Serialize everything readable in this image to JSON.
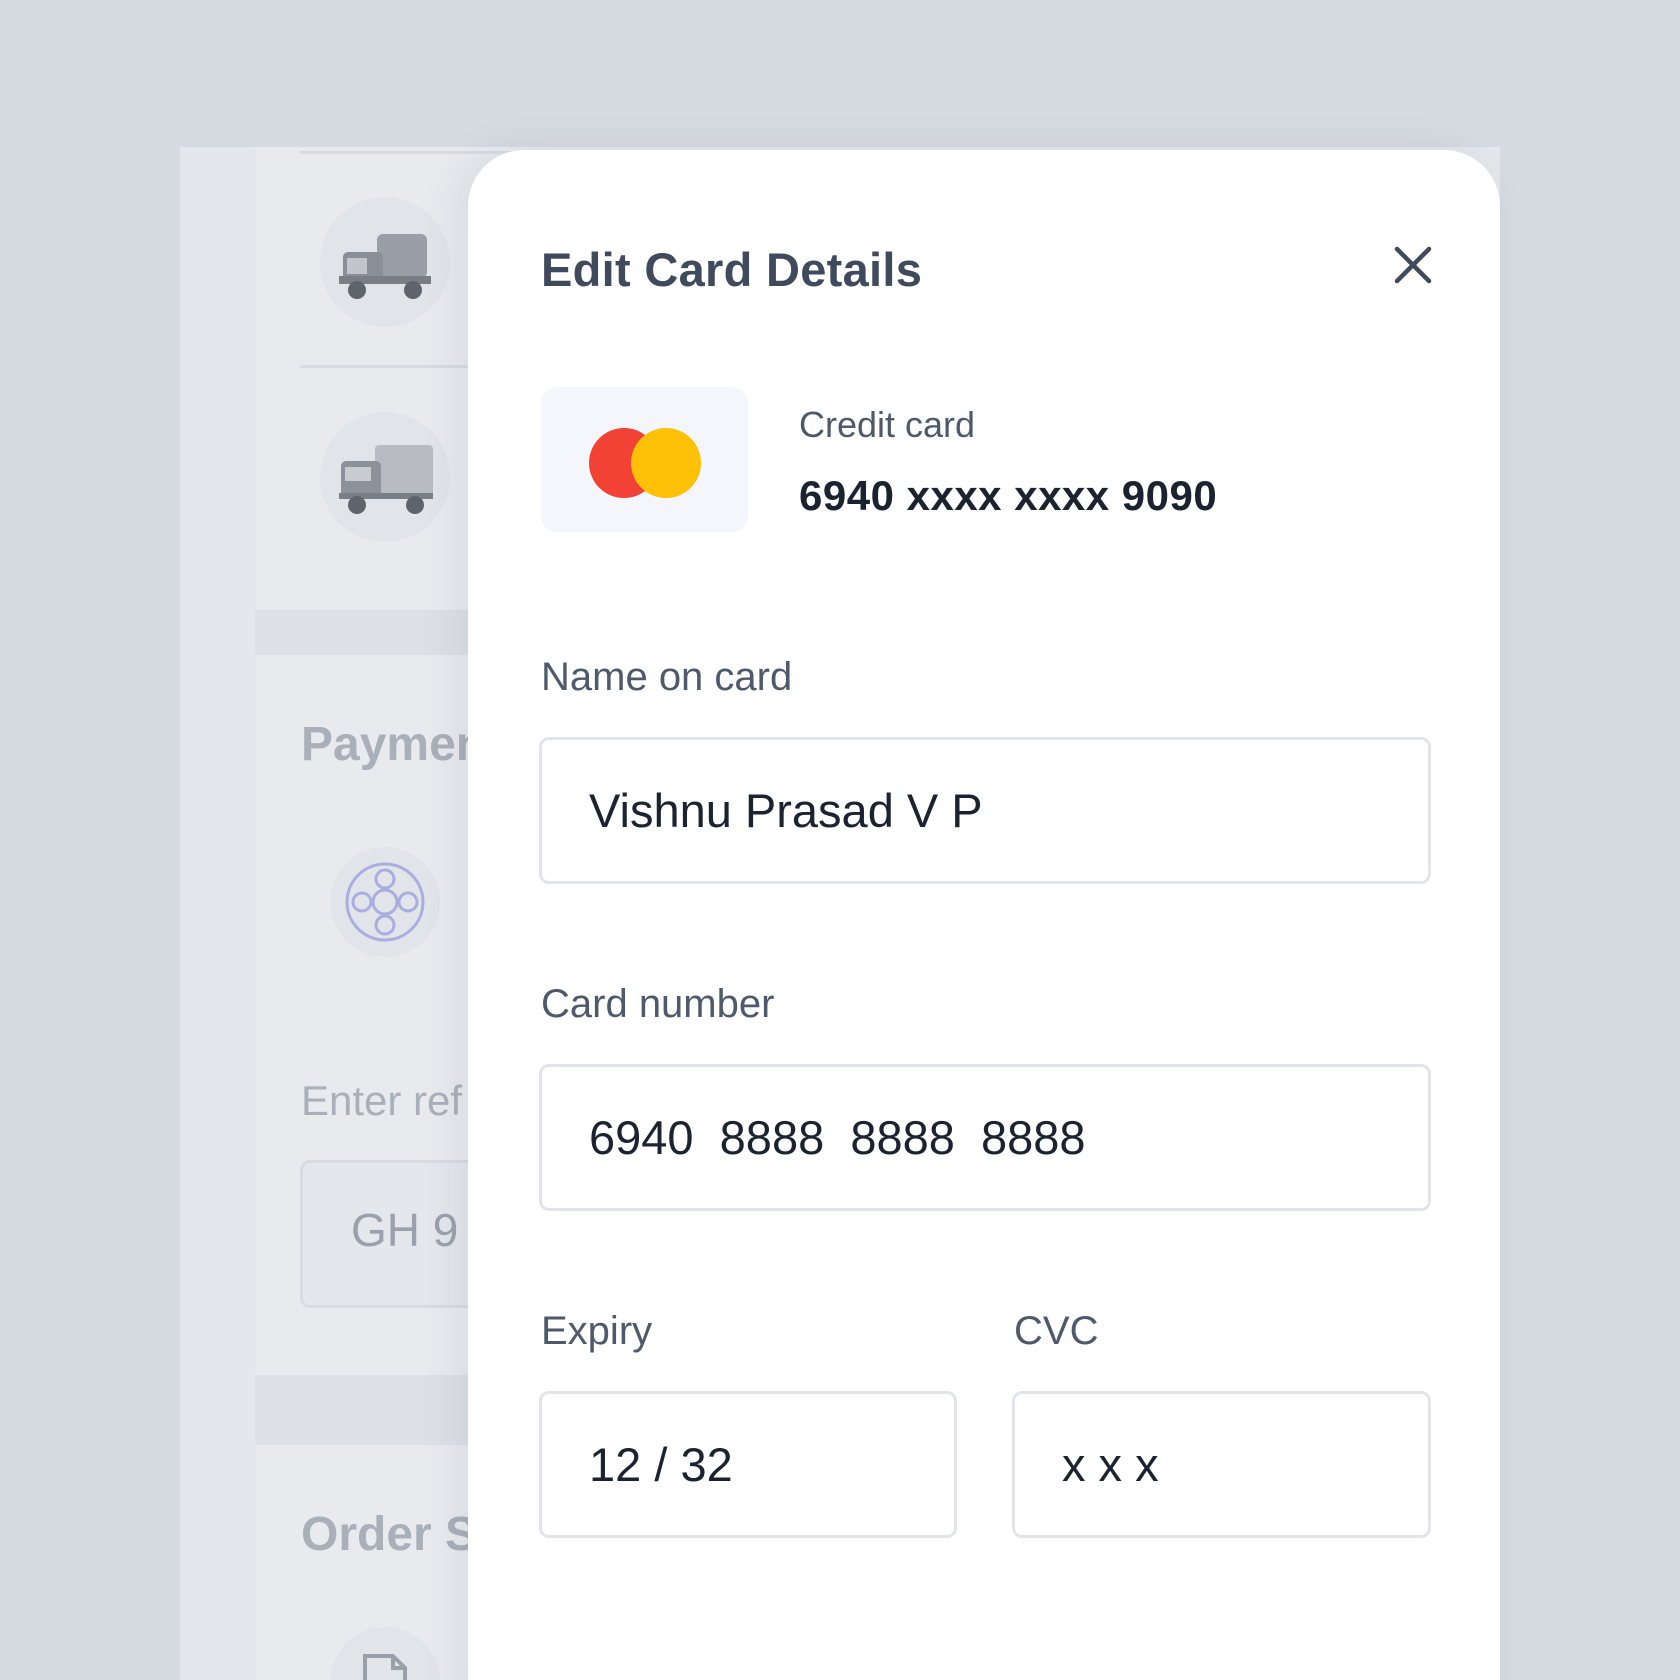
{
  "modal": {
    "title": "Edit Card Details",
    "close_icon": "close-icon"
  },
  "card": {
    "logo_icon": "mastercard-logo",
    "type_label": "Credit card",
    "masked_number": "6940 xxxx xxxx 9090",
    "brand_colors": {
      "left": "#f24236",
      "right": "#ffc107"
    }
  },
  "form": {
    "name": {
      "label": "Name on card",
      "value": "Vishnu Prasad V P"
    },
    "number": {
      "label": "Card number",
      "value": "6940  8888  8888  8888"
    },
    "expiry": {
      "label": "Expiry",
      "value": "12 / 32"
    },
    "cvc": {
      "label": "CVC",
      "value": "x x x"
    }
  },
  "background": {
    "payment_heading": "Paymen",
    "reference_label": "Enter ref",
    "reference_value": "GH 9",
    "order_heading": "Order S"
  },
  "colors": {
    "backdrop": "#d6dae1",
    "title_text": "#3f4a5c",
    "label_text": "#4e5a6c",
    "value_text": "#1c2330",
    "field_border": "#e2e4e9"
  }
}
